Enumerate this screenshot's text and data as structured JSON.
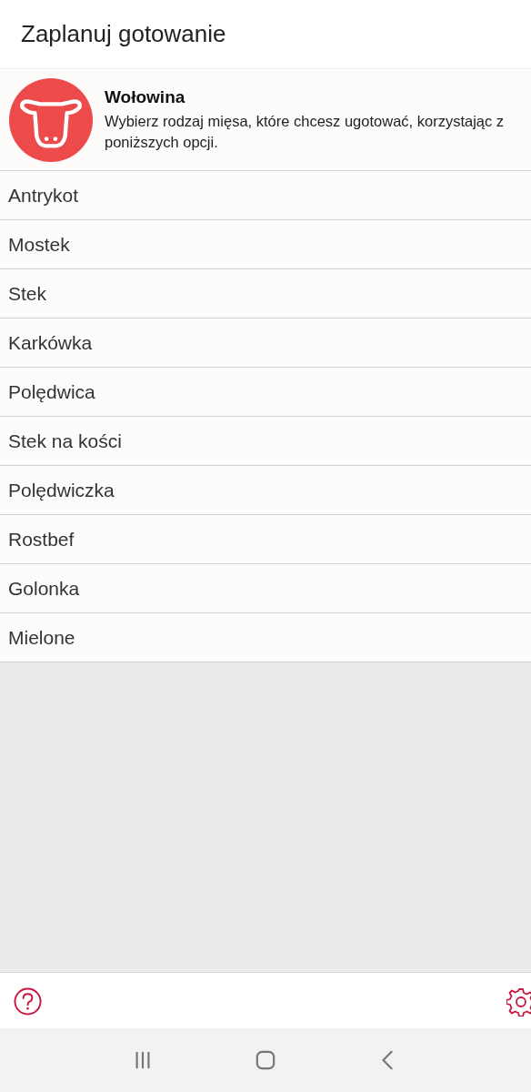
{
  "header": {
    "title": "Zaplanuj gotowanie"
  },
  "category": {
    "name": "Wołowina",
    "description": "Wybierz rodzaj mięsa, które chcesz ugotować, korzystając z poniższych opcji."
  },
  "items": [
    {
      "label": "Antrykot"
    },
    {
      "label": "Mostek"
    },
    {
      "label": "Stek"
    },
    {
      "label": "Karkówka"
    },
    {
      "label": "Polędwica"
    },
    {
      "label": "Stek na kości"
    },
    {
      "label": "Polędwiczka"
    },
    {
      "label": "Rostbef"
    },
    {
      "label": "Golonka"
    },
    {
      "label": "Mielone"
    }
  ]
}
